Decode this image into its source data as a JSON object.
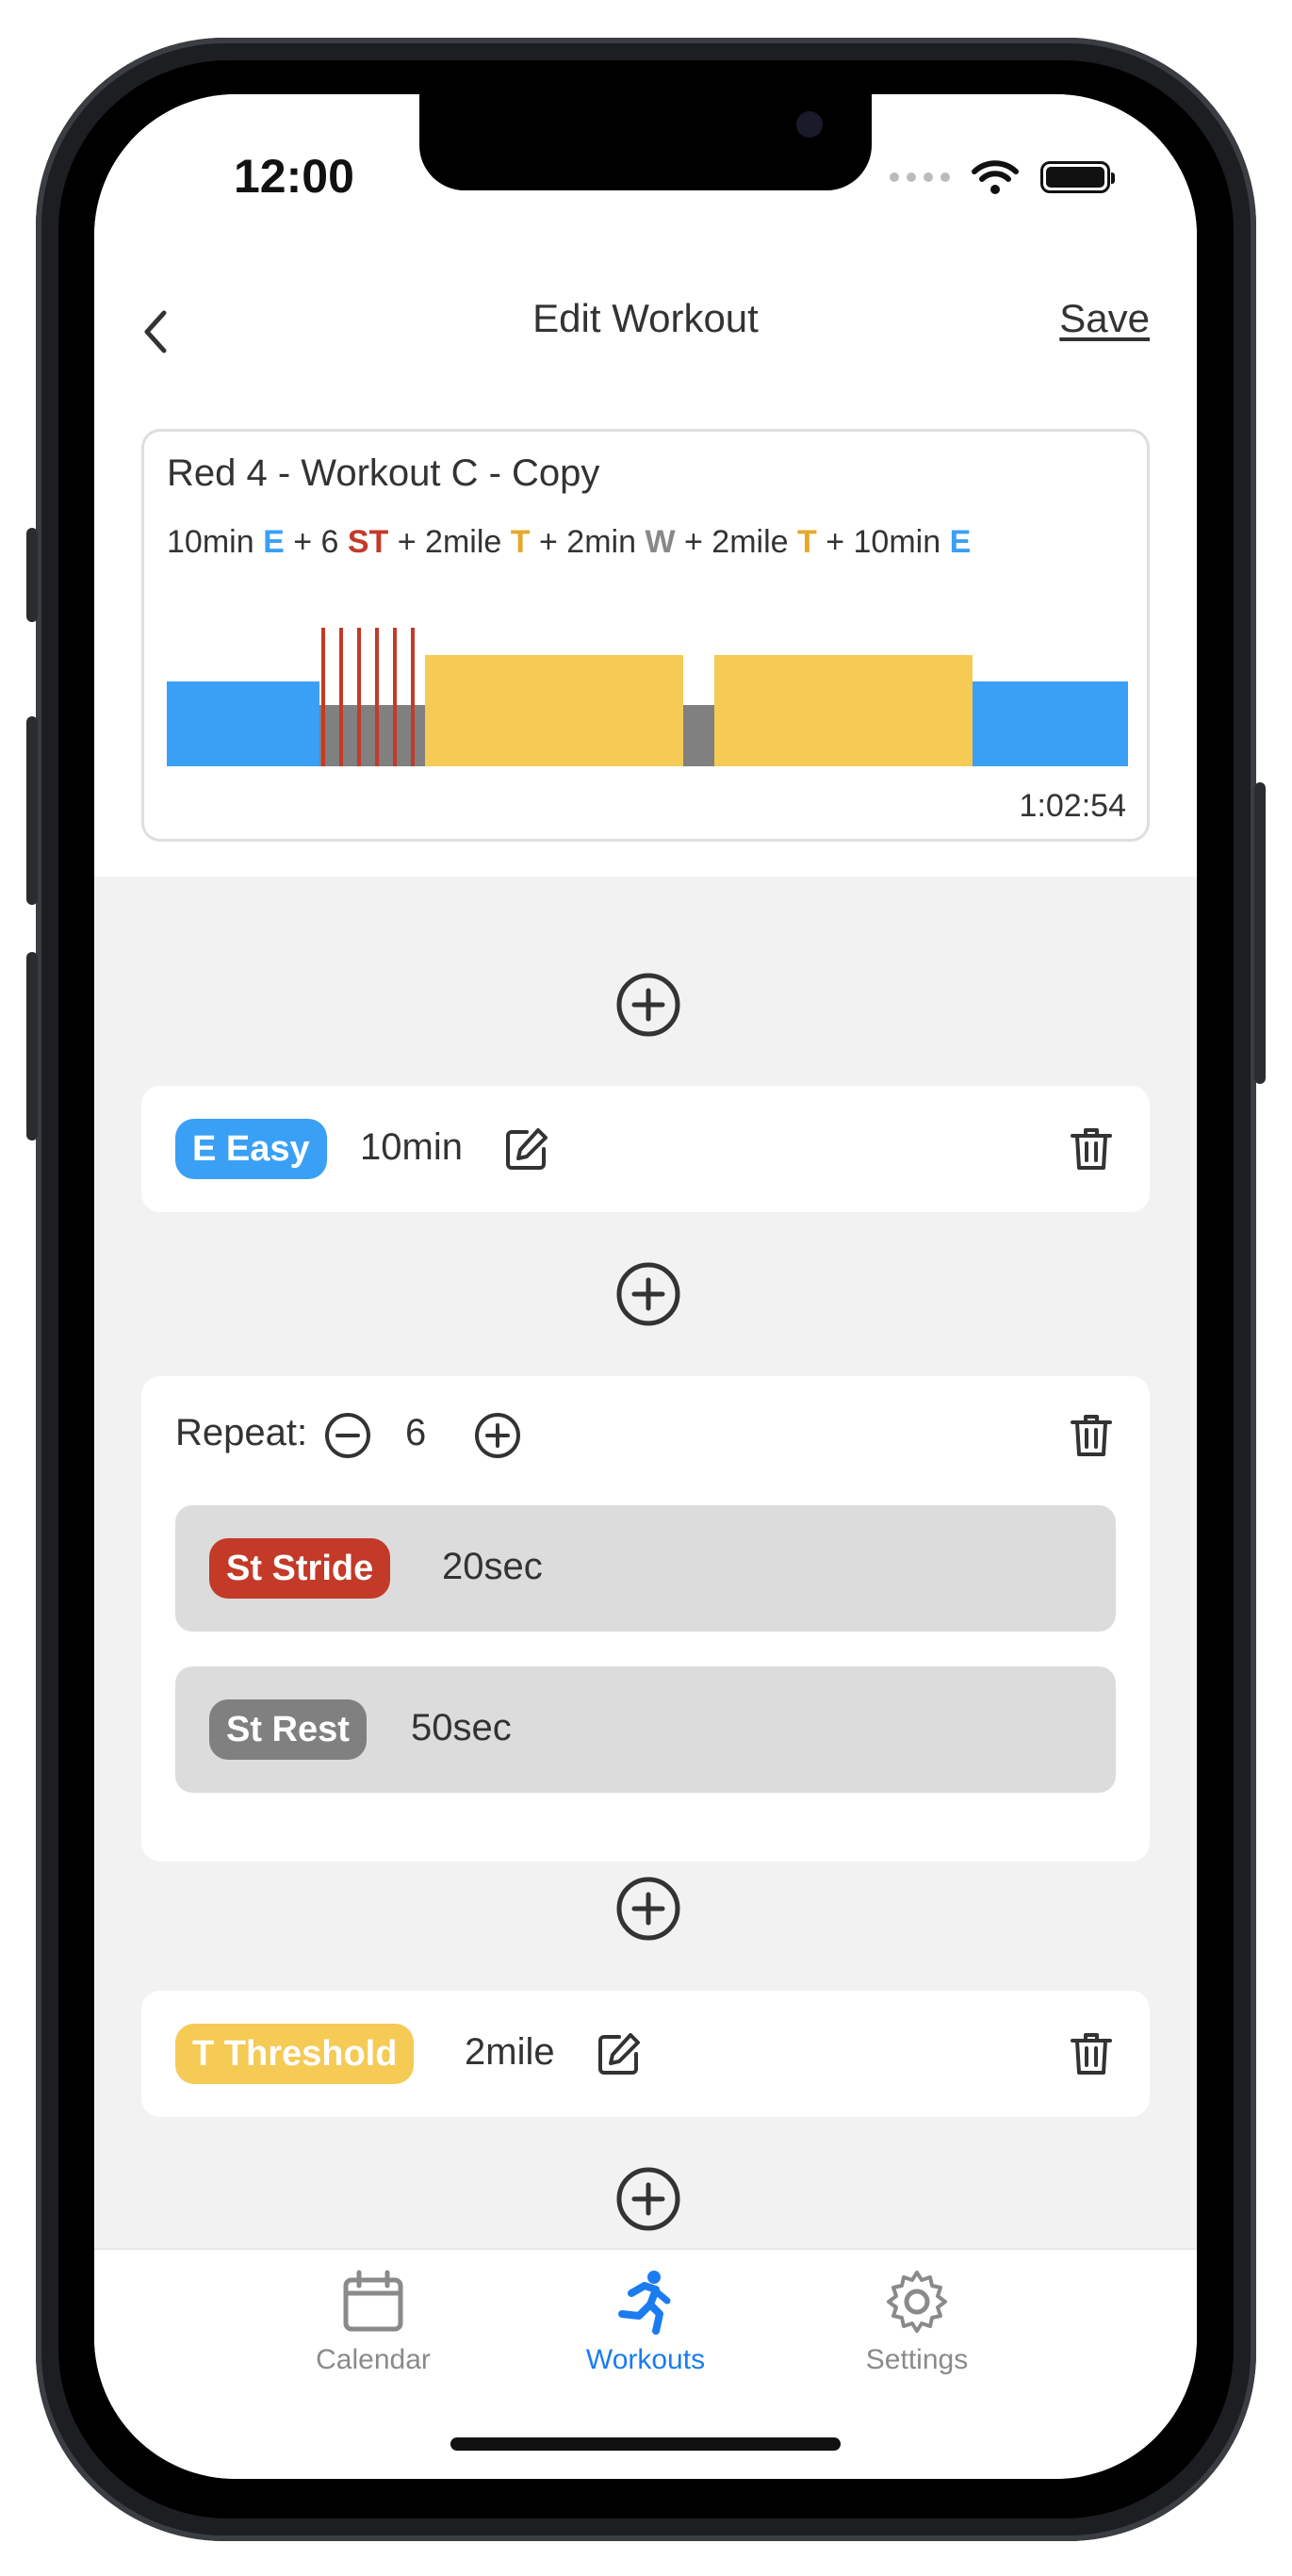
{
  "status": {
    "time": "12:00"
  },
  "nav": {
    "title": "Edit Workout",
    "save_label": "Save"
  },
  "summary": {
    "name": "Red 4 - Workout C - Copy",
    "formula": [
      {
        "text": "10min ",
        "code": "E",
        "color": "#3aa0f5"
      },
      {
        "text": " + 6 ",
        "code": "ST",
        "color": "#c33a28"
      },
      {
        "text": " + 2mile ",
        "code": "T",
        "color": "#e5a92a"
      },
      {
        "text": " + 2min ",
        "code": "W",
        "color": "#888888"
      },
      {
        "text": " + 2mile ",
        "code": "T",
        "color": "#e5a92a"
      },
      {
        "text": " + 10min ",
        "code": "E",
        "color": "#3aa0f5"
      }
    ],
    "duration": "1:02:54"
  },
  "steps": {
    "easy": {
      "tag": "E Easy",
      "value": "10min",
      "color": "#3aa0f5"
    },
    "repeat": {
      "label": "Repeat:",
      "count": "6",
      "stride": {
        "tag": "St Stride",
        "value": "20sec",
        "color": "#c33a28"
      },
      "rest": {
        "tag": "St Rest",
        "value": "50sec",
        "color": "#808080"
      }
    },
    "threshold": {
      "tag": "T Threshold",
      "value": "2mile",
      "color": "#f5ca55"
    }
  },
  "tabs": {
    "calendar": "Calendar",
    "workouts": "Workouts",
    "settings": "Settings",
    "active_color": "#1a7cf0",
    "inactive_color": "#8a8a8a"
  },
  "icons": [
    "back-chevron-icon",
    "plus-circle-icon",
    "edit-icon",
    "trash-icon",
    "minus-circle-icon",
    "calendar-icon",
    "runner-icon",
    "gear-icon"
  ]
}
